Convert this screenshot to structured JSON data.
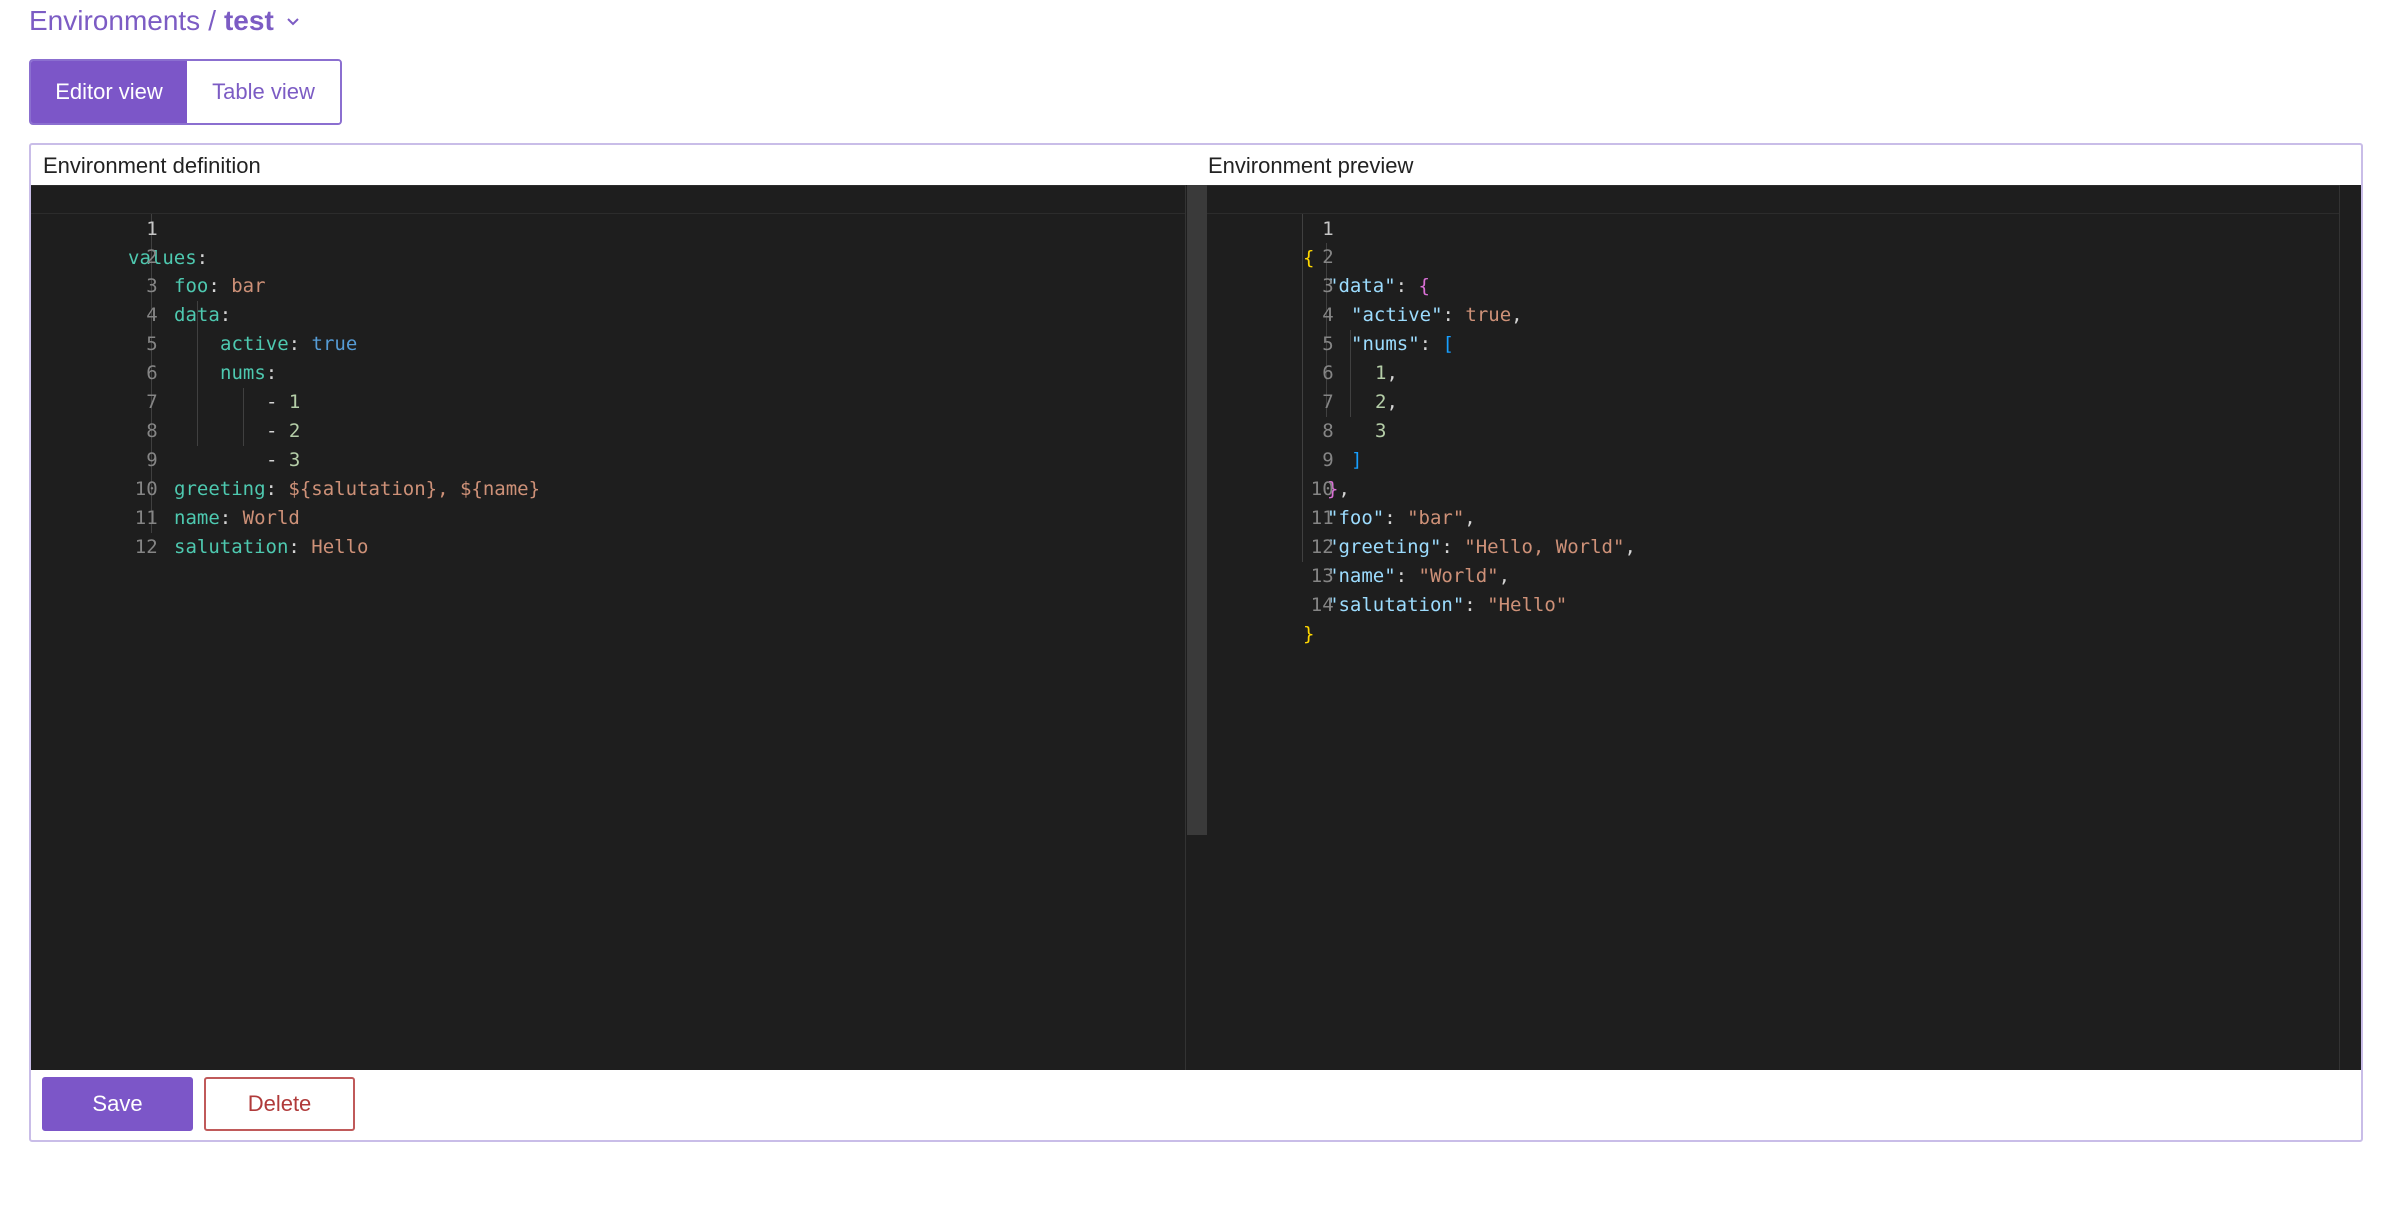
{
  "breadcrumb": {
    "parent": "Environments",
    "separator": "/",
    "current": "test",
    "dropdown_icon": "chevron-down-icon"
  },
  "tabs": [
    {
      "label": "Editor view",
      "active": true
    },
    {
      "label": "Table view",
      "active": false
    }
  ],
  "definition": {
    "title": "Environment definition",
    "lines": [
      {
        "n": "1",
        "code": "values:"
      },
      {
        "n": "2",
        "code": "foo: bar"
      },
      {
        "n": "3",
        "code": "data:"
      },
      {
        "n": "4",
        "code": "active: true"
      },
      {
        "n": "5",
        "code": "nums:"
      },
      {
        "n": "6",
        "code": "- 1"
      },
      {
        "n": "7",
        "code": "- 2"
      },
      {
        "n": "8",
        "code": "- 3"
      },
      {
        "n": "9",
        "code": "greeting: ${salutation}, ${name}"
      },
      {
        "n": "10",
        "code": "name: World"
      },
      {
        "n": "11",
        "code": "salutation: Hello"
      },
      {
        "n": "12",
        "code": ""
      }
    ]
  },
  "preview": {
    "title": "Environment preview",
    "lines": [
      {
        "n": "1",
        "code": "{"
      },
      {
        "n": "2",
        "code": "\"data\": {"
      },
      {
        "n": "3",
        "code": "\"active\": true,"
      },
      {
        "n": "4",
        "code": "\"nums\": ["
      },
      {
        "n": "5",
        "code": "1,"
      },
      {
        "n": "6",
        "code": "2,"
      },
      {
        "n": "7",
        "code": "3"
      },
      {
        "n": "8",
        "code": "]"
      },
      {
        "n": "9",
        "code": "},"
      },
      {
        "n": "10",
        "code": "\"foo\": \"bar\","
      },
      {
        "n": "11",
        "code": "\"greeting\": \"Hello, World\","
      },
      {
        "n": "12",
        "code": "\"name\": \"World\","
      },
      {
        "n": "13",
        "code": "\"salutation\": \"Hello\""
      },
      {
        "n": "14",
        "code": "}"
      }
    ]
  },
  "actions": {
    "save_label": "Save",
    "delete_label": "Delete"
  },
  "colors": {
    "accent": "#7c56c8",
    "danger": "#b03a3a",
    "editor_bg": "#1e1e1e"
  }
}
